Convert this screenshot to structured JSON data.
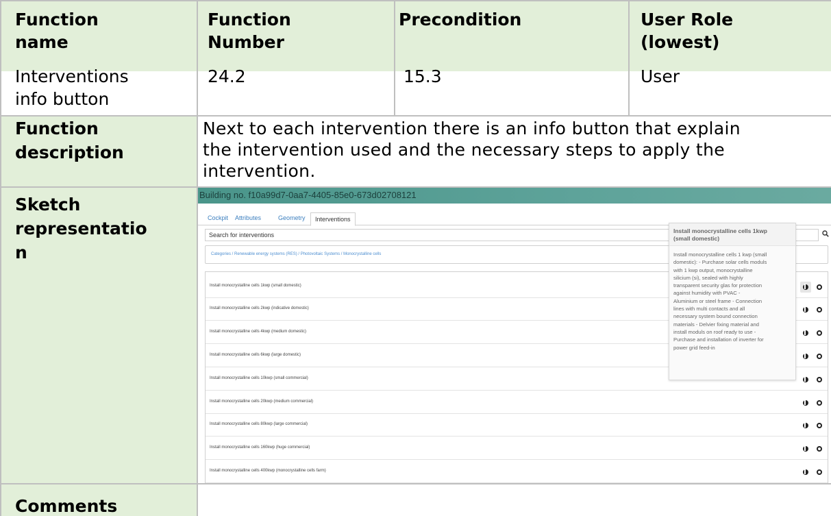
{
  "table": {
    "headers": {
      "function_name": [
        "Function",
        "name"
      ],
      "function_number": [
        "Function",
        "Number"
      ],
      "precondition": "Precondition",
      "user_role": [
        "User Role",
        "(lowest)"
      ]
    },
    "row": {
      "function_name": [
        "Interventions",
        "info button"
      ],
      "function_number": "24.2",
      "precondition": "15.3",
      "user_role": "User"
    },
    "description_label": [
      "Function",
      "description"
    ],
    "description_text": [
      "Next to each intervention there is an info button that explain",
      "the intervention used and the necessary steps to apply the",
      "intervention."
    ],
    "sketch_label": [
      "Sketch",
      "representatio",
      "n"
    ],
    "comments_label": "Comments",
    "header_color": "#e2efd9"
  },
  "sketch": {
    "banner_text": "Building no. f10a99d7-0aa7-4405-85e0-673d02708121",
    "tabs": [
      "Cockpit",
      "Attributes",
      "Geometry",
      "Interventions"
    ],
    "active_tab": "Interventions",
    "search_placeholder": "Search for interventions",
    "search_icon": "search-icon",
    "breadcrumb": "Categories  /  Renewable energy systems (RES)  /  Photovoltaic Systems  /  Monocrystalline cells",
    "items": [
      "Install monocrystalline cells 1kwp (small domestic)",
      "Install monocrystalline cells 2kwp (indicative domestic)",
      "Install monocrystalline cells 4kwp (medium domestic)",
      "Install monocrystalline cells 6kwp (large domestic)",
      "Install monocrystalline cells 10kwp (small commercial)",
      "Install monocrystalline cells 20kwp (medium commercial)",
      "Install monocrystalline cells 80kwp (large commercial)",
      "Install monocrystalline cells 160kwp (huge commercial)",
      "Install monocrystalline cells 400kwp (monocrystalline cells farm)"
    ],
    "tooltip": {
      "title": [
        "Install monocrystalline cells 1kwp",
        "(small domestic)"
      ],
      "body": [
        "Install monocrystalline cells 1 kwp (small",
        "domestic): - Purchase solar cells moduls",
        "with 1 kwp output, monocrystalline",
        "silicium (si), sealed with highly",
        "transparent security glas for protection",
        "against humidity with PVAC -",
        "Aluminium or steel frame - Connection",
        "lines with multi contacts and all",
        "necessary system bound connection",
        "materials - Delvier fixing material and",
        "install moduls on roof ready to use -",
        "Purchase and installation of inverter for",
        "power grid feed-in"
      ]
    }
  }
}
